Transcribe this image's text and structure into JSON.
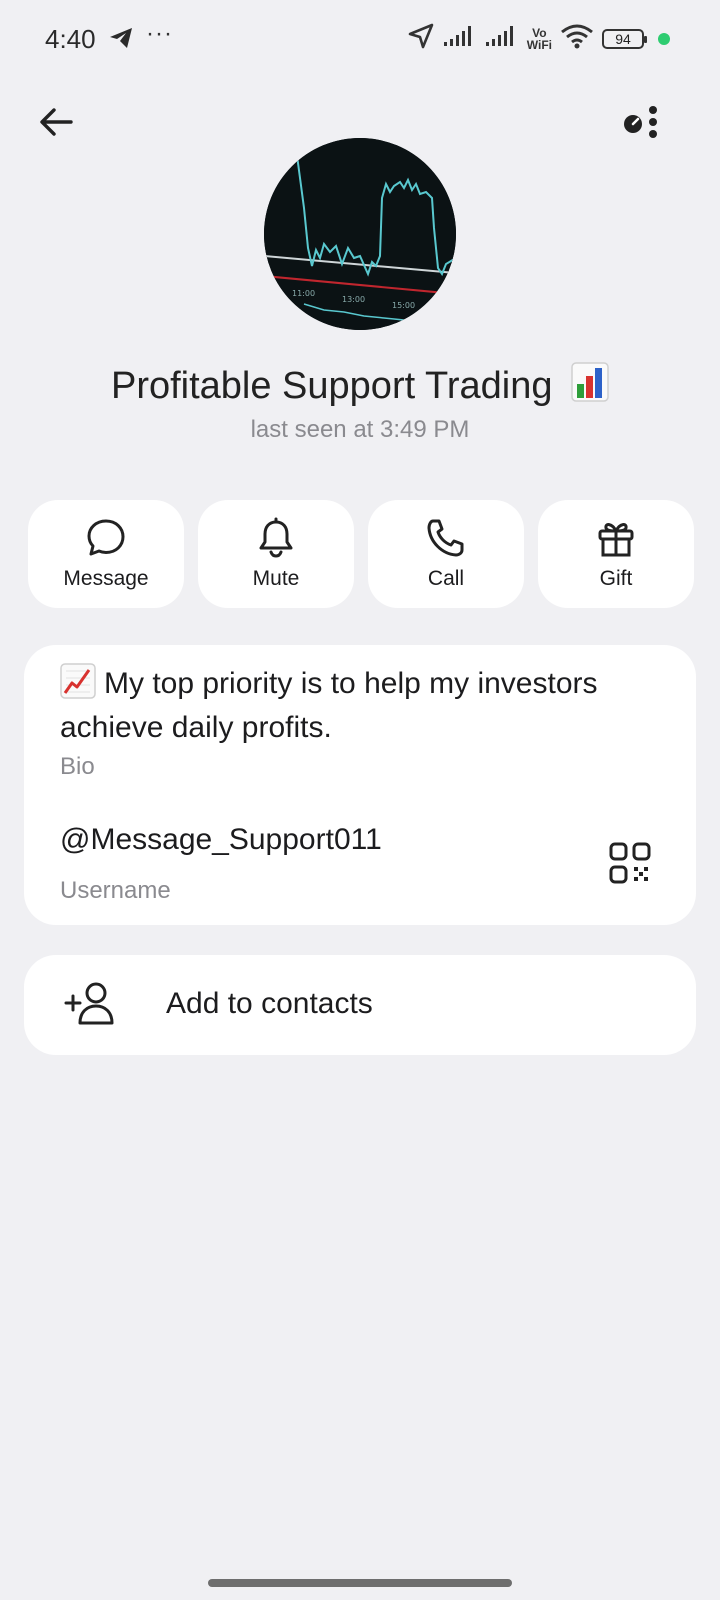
{
  "status_bar": {
    "time": "4:40",
    "dots": "···",
    "vowifi_top": "Vo",
    "vowifi_bottom": "WiFi",
    "battery": "94",
    "icons": [
      "telegram-icon",
      "location-icon",
      "signal-icon",
      "signal-icon",
      "wifi-icon",
      "battery-icon"
    ]
  },
  "header": {
    "back_icon": "arrow-left-icon",
    "more_icon": "more-vertical-icon"
  },
  "profile": {
    "name": "Profitable Support Trading",
    "name_emoji": "bar-chart-emoji",
    "last_seen": "last seen at 3:49 PM"
  },
  "actions": [
    {
      "label": "Message",
      "icon": "message-bubble-icon"
    },
    {
      "label": "Mute",
      "icon": "bell-icon"
    },
    {
      "label": "Call",
      "icon": "phone-icon"
    },
    {
      "label": "Gift",
      "icon": "gift-icon"
    }
  ],
  "info": {
    "bio": "My top priority is to help my investors achieve daily profits.",
    "bio_emoji": "chart-increasing-emoji",
    "bio_label": "Bio",
    "username": "@Message_Support011",
    "username_label": "Username"
  },
  "add_contact": {
    "label": "Add to contacts",
    "icon": "add-person-icon"
  },
  "colors": {
    "background": "#f0f0f3",
    "card": "#ffffff",
    "secondary_text": "#8a8a8f",
    "status_green": "#2ecc71"
  }
}
